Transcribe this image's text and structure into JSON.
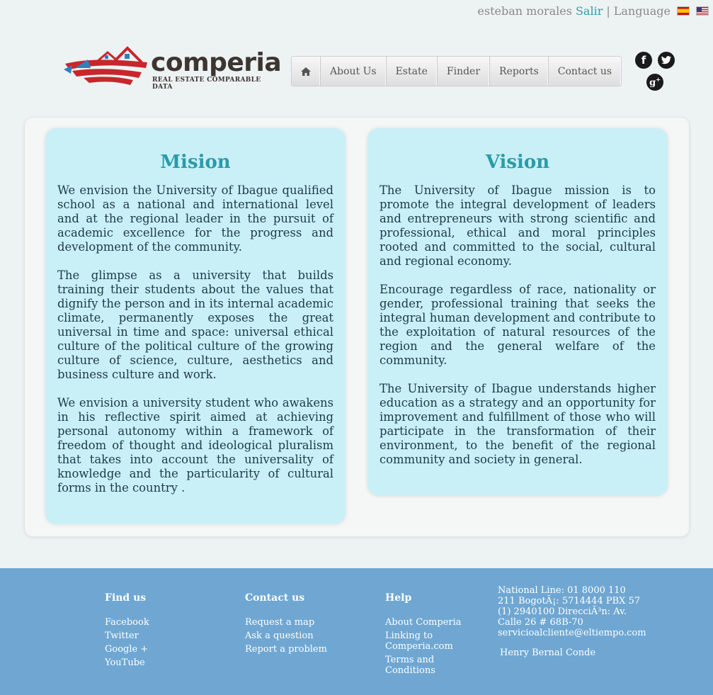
{
  "topbar": {
    "user": "esteban morales",
    "logout": "Salir",
    "separator": "|",
    "language": "Language"
  },
  "logo": {
    "name": "comperia",
    "tagline": "REAL ESTATE COMPARABLE DATA"
  },
  "nav": {
    "items": [
      "About Us",
      "Estate",
      "Finder",
      "Reports",
      "Contact us"
    ]
  },
  "mission": {
    "title": "Mision",
    "paragraphs": [
      "We envision the University of Ibague qualified school as a national and international level and at the regional leader in the pursuit of academic excellence for the progress and development of the community.",
      "The glimpse as a university that builds training their students about the values that dignify the person and in its internal academic climate, permanently exposes the great universal in time and space: universal ethical culture of the political culture of the growing culture of science, culture, aesthetics and business culture and work.",
      "We envision a university student who awakens in his reflective spirit aimed at achieving personal autonomy within a framework of freedom of thought and ideological pluralism that takes into account the universality of knowledge and the particularity of cultural forms in the country ."
    ]
  },
  "vision": {
    "title": "Vision",
    "paragraphs": [
      "The University of Ibague mission is to promote the integral development of leaders and entrepreneurs with strong scientific and professional, ethical and moral principles rooted and committed to the social, cultural and regional economy.",
      "Encourage regardless of race, nationality or gender, professional training that seeks the integral human development and contribute to the exploitation of natural resources of the region and the general welfare of the community.",
      "The University of Ibague understands higher education as a strategy and an opportunity for improvement and fulfillment of those who will participate in the transformation of their environment, to the benefit of the regional community and society in general."
    ]
  },
  "footer": {
    "find_us": {
      "title": "Find us",
      "links": [
        "Facebook",
        "Twitter",
        "Google +",
        "YouTube"
      ]
    },
    "contact_us": {
      "title": "Contact us",
      "links": [
        "Request a map",
        "Ask a question",
        "Report a problem"
      ]
    },
    "help": {
      "title": "Help",
      "links": [
        "About Comperia",
        "Linking to Comperia.com",
        "Terms and Conditions"
      ]
    },
    "contact_info": [
      "National Line: 01 8000 110",
      "211 BogotÃ¡: 5714444 PBX 57",
      "(1) 2940100 DirecciÃ³n: Av.",
      "Calle 26 # 68B-70",
      "servicioalcliente@eltiempo.com"
    ],
    "author": "Henry Bernal Conde"
  },
  "colors": {
    "accent": "#2b9ba8",
    "card_bg": "#c9f0f6",
    "footer_bg": "#6fa7d2",
    "body_text": "#1c3a4a"
  },
  "icons": {
    "nav_home": "home-icon",
    "social": [
      "facebook-icon",
      "twitter-icon",
      "google-plus-icon"
    ],
    "flags": [
      "spain-flag-icon",
      "usa-flag-icon"
    ]
  }
}
